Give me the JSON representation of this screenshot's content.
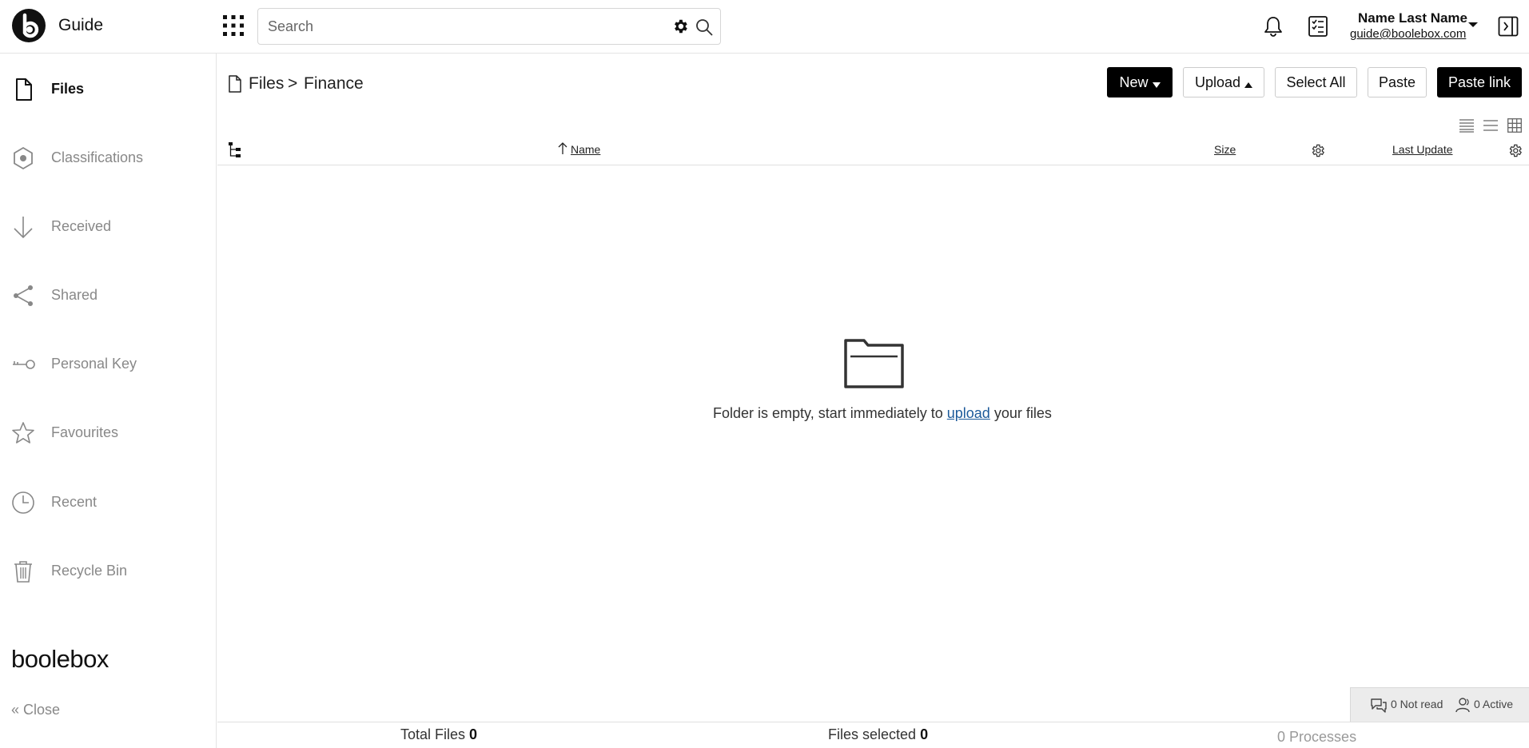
{
  "header": {
    "app_title": "Guide",
    "search_placeholder": "Search",
    "user_name": "Name Last Name",
    "user_email": "guide@boolebox.com"
  },
  "sidebar": {
    "items": [
      {
        "label": "Files",
        "icon": "file-icon",
        "active": true
      },
      {
        "label": "Classifications",
        "icon": "hexagon-icon",
        "active": false
      },
      {
        "label": "Received",
        "icon": "arrow-down-icon",
        "active": false
      },
      {
        "label": "Shared",
        "icon": "share-icon",
        "active": false
      },
      {
        "label": "Personal Key",
        "icon": "key-icon",
        "active": false
      },
      {
        "label": "Favourites",
        "icon": "star-icon",
        "active": false
      },
      {
        "label": "Recent",
        "icon": "clock-icon",
        "active": false
      },
      {
        "label": "Recycle Bin",
        "icon": "trash-icon",
        "active": false
      }
    ],
    "brand": "boolebox",
    "close_label": "Close"
  },
  "breadcrumb": {
    "root": "Files",
    "separator": ">",
    "current": "Finance"
  },
  "toolbar": {
    "new_label": "New",
    "upload_label": "Upload",
    "select_all_label": "Select All",
    "paste_label": "Paste",
    "paste_link_label": "Paste link"
  },
  "columns": {
    "name": "Name",
    "size": "Size",
    "last_update": "Last Update"
  },
  "empty_state": {
    "before": "Folder is empty, start immediately to ",
    "link": "upload",
    "after": " your files"
  },
  "status": {
    "not_read": "0 Not read",
    "active": "0 Active"
  },
  "footer": {
    "total_files_label": "Total Files",
    "total_files_value": "0",
    "files_selected_label": "Files selected",
    "files_selected_value": "0",
    "processes_value": "0",
    "processes_label": "Processes"
  },
  "colors": {
    "primary_button": "#000000",
    "link": "#1c5a9a",
    "muted_text": "#888888"
  }
}
